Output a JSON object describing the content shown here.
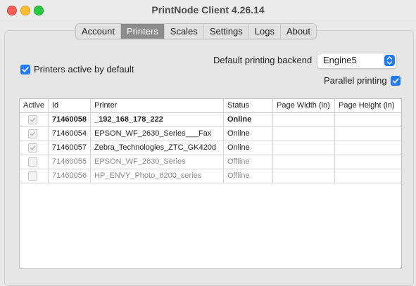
{
  "window": {
    "title": "PrintNode Client 4.26.14"
  },
  "tabs": [
    {
      "label": "Account",
      "active": false
    },
    {
      "label": "Printers",
      "active": true
    },
    {
      "label": "Scales",
      "active": false
    },
    {
      "label": "Settings",
      "active": false
    },
    {
      "label": "Logs",
      "active": false
    },
    {
      "label": "About",
      "active": false
    }
  ],
  "options": {
    "active_by_default_label": "Printers active by default",
    "active_by_default_checked": true,
    "backend_label": "Default printing backend",
    "backend_value": "Engine5",
    "parallel_label": "Parallel printing",
    "parallel_checked": true
  },
  "table": {
    "headers": [
      "Active",
      "Id",
      "Printer",
      "Status",
      "Page Width (in)",
      "Page Height (in)"
    ],
    "rows": [
      {
        "active": true,
        "id": "71460058",
        "printer": "_192_168_178_222",
        "status": "Online",
        "page_width": "",
        "page_height": "",
        "bold": true
      },
      {
        "active": true,
        "id": "71460054",
        "printer": "EPSON_WF_2630_Series___Fax",
        "status": "Online",
        "page_width": "",
        "page_height": "",
        "bold": false
      },
      {
        "active": true,
        "id": "71460057",
        "printer": "Zebra_Technologies_ZTC_GK420d",
        "status": "Online",
        "page_width": "",
        "page_height": "",
        "bold": false
      },
      {
        "active": false,
        "id": "71460055",
        "printer": "EPSON_WF_2630_Series",
        "status": "Offline",
        "page_width": "",
        "page_height": "",
        "bold": false
      },
      {
        "active": false,
        "id": "71460056",
        "printer": "HP_ENVY_Photo_6200_series",
        "status": "Offline",
        "page_width": "",
        "page_height": "",
        "bold": false
      }
    ]
  },
  "colors": {
    "accent": "#1f7cf6",
    "active_tab": "#8c8c8c"
  }
}
